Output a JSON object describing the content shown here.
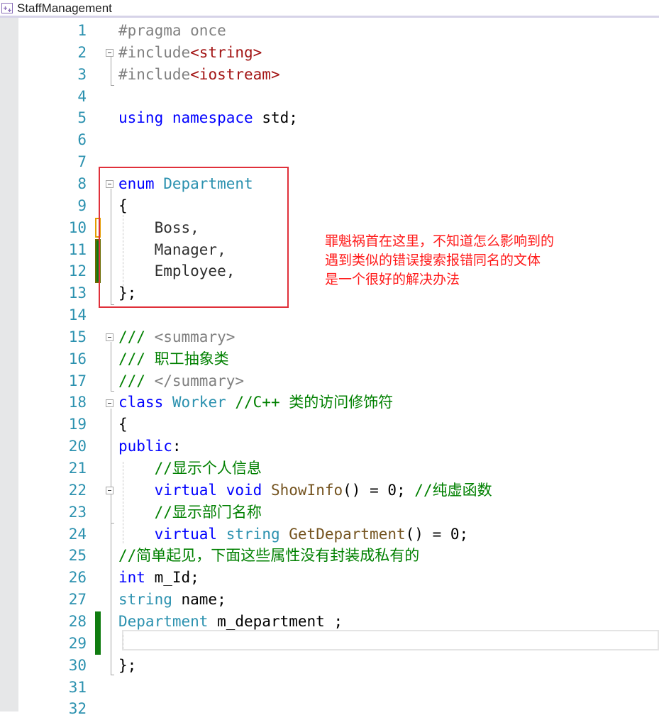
{
  "window": {
    "tab_title": "StaffManagement"
  },
  "colors": {
    "keyword": "#0000ff",
    "type": "#2b91af",
    "string": "#a31515",
    "comment": "#008000",
    "doc_tag": "#808080",
    "preprocessor": "#808080",
    "function": "#74531f",
    "enum_member": "#2f2f2f",
    "annotation_red": "#ff1a1a",
    "change_saved": "#107c10",
    "change_unsaved": "#e39c00"
  },
  "editor": {
    "current_line": 29,
    "lines": [
      {
        "n": "1",
        "tokens": [
          {
            "t": "#pragma once",
            "c": "preprocessor"
          }
        ]
      },
      {
        "n": "2",
        "tokens": [
          {
            "t": "#include",
            "c": "preprocessor"
          },
          {
            "t": "<string>",
            "c": "string"
          }
        ]
      },
      {
        "n": "3",
        "tokens": [
          {
            "t": "#include",
            "c": "preprocessor"
          },
          {
            "t": "<iostream>",
            "c": "string"
          }
        ]
      },
      {
        "n": "4",
        "tokens": []
      },
      {
        "n": "5",
        "tokens": [
          {
            "t": "using",
            "c": "keyword"
          },
          {
            "t": " ",
            "c": "plain"
          },
          {
            "t": "namespace",
            "c": "keyword"
          },
          {
            "t": " std;",
            "c": "plain"
          }
        ]
      },
      {
        "n": "6",
        "tokens": []
      },
      {
        "n": "7",
        "tokens": []
      },
      {
        "n": "8",
        "tokens": [
          {
            "t": "enum",
            "c": "keyword"
          },
          {
            "t": " ",
            "c": "plain"
          },
          {
            "t": "Department",
            "c": "type"
          }
        ]
      },
      {
        "n": "9",
        "tokens": [
          {
            "t": "{",
            "c": "plain"
          }
        ]
      },
      {
        "n": "10",
        "tokens": [
          {
            "t": "    Boss,",
            "c": "enum_member"
          }
        ]
      },
      {
        "n": "11",
        "tokens": [
          {
            "t": "    Manager,",
            "c": "enum_member"
          }
        ]
      },
      {
        "n": "12",
        "tokens": [
          {
            "t": "    Employee,",
            "c": "enum_member"
          }
        ]
      },
      {
        "n": "13",
        "tokens": [
          {
            "t": "};",
            "c": "plain"
          }
        ]
      },
      {
        "n": "14",
        "tokens": []
      },
      {
        "n": "15",
        "tokens": [
          {
            "t": "///",
            "c": "comment"
          },
          {
            "t": " <summary>",
            "c": "doc_tag"
          }
        ]
      },
      {
        "n": "16",
        "tokens": [
          {
            "t": "/// 职工抽象类",
            "c": "comment"
          }
        ]
      },
      {
        "n": "17",
        "tokens": [
          {
            "t": "///",
            "c": "comment"
          },
          {
            "t": " </summary>",
            "c": "doc_tag"
          }
        ]
      },
      {
        "n": "18",
        "tokens": [
          {
            "t": "class",
            "c": "keyword"
          },
          {
            "t": " ",
            "c": "plain"
          },
          {
            "t": "Worker",
            "c": "type"
          },
          {
            "t": " //C++ 类的访问修饰符",
            "c": "comment"
          }
        ]
      },
      {
        "n": "19",
        "tokens": [
          {
            "t": "{",
            "c": "plain"
          }
        ]
      },
      {
        "n": "20",
        "tokens": [
          {
            "t": "public",
            "c": "keyword"
          },
          {
            "t": ":",
            "c": "plain"
          }
        ]
      },
      {
        "n": "21",
        "tokens": [
          {
            "t": "    //显示个人信息",
            "c": "comment"
          }
        ]
      },
      {
        "n": "22",
        "tokens": [
          {
            "t": "    ",
            "c": "plain"
          },
          {
            "t": "virtual",
            "c": "keyword"
          },
          {
            "t": " ",
            "c": "plain"
          },
          {
            "t": "void",
            "c": "keyword"
          },
          {
            "t": " ",
            "c": "plain"
          },
          {
            "t": "ShowInfo",
            "c": "function"
          },
          {
            "t": "() = 0; ",
            "c": "plain"
          },
          {
            "t": "//纯虚函数",
            "c": "comment"
          }
        ]
      },
      {
        "n": "23",
        "tokens": [
          {
            "t": "    //显示部门名称",
            "c": "comment"
          }
        ]
      },
      {
        "n": "24",
        "tokens": [
          {
            "t": "    ",
            "c": "plain"
          },
          {
            "t": "virtual",
            "c": "keyword"
          },
          {
            "t": " ",
            "c": "plain"
          },
          {
            "t": "string",
            "c": "type"
          },
          {
            "t": " ",
            "c": "plain"
          },
          {
            "t": "GetDepartment",
            "c": "function"
          },
          {
            "t": "() = 0;",
            "c": "plain"
          }
        ]
      },
      {
        "n": "25",
        "tokens": [
          {
            "t": "//简单起见，下面这些属性没有封装成私有的",
            "c": "comment"
          }
        ]
      },
      {
        "n": "26",
        "tokens": [
          {
            "t": "int",
            "c": "keyword"
          },
          {
            "t": " m_Id;",
            "c": "plain"
          }
        ]
      },
      {
        "n": "27",
        "tokens": [
          {
            "t": "string",
            "c": "type"
          },
          {
            "t": " name;",
            "c": "plain"
          }
        ]
      },
      {
        "n": "28",
        "tokens": [
          {
            "t": "Department",
            "c": "type"
          },
          {
            "t": " m_department ;",
            "c": "plain"
          }
        ]
      },
      {
        "n": "29",
        "tokens": []
      },
      {
        "n": "30",
        "tokens": [
          {
            "t": "};",
            "c": "plain"
          }
        ]
      },
      {
        "n": "31",
        "tokens": []
      },
      {
        "n": "32",
        "tokens": []
      }
    ]
  },
  "annotation": {
    "lines": [
      "罪魁祸首在这里，不知道怎么影响到的",
      "遇到类似的错误搜索报错同名的文体",
      "是一个很好的解决办法"
    ]
  }
}
